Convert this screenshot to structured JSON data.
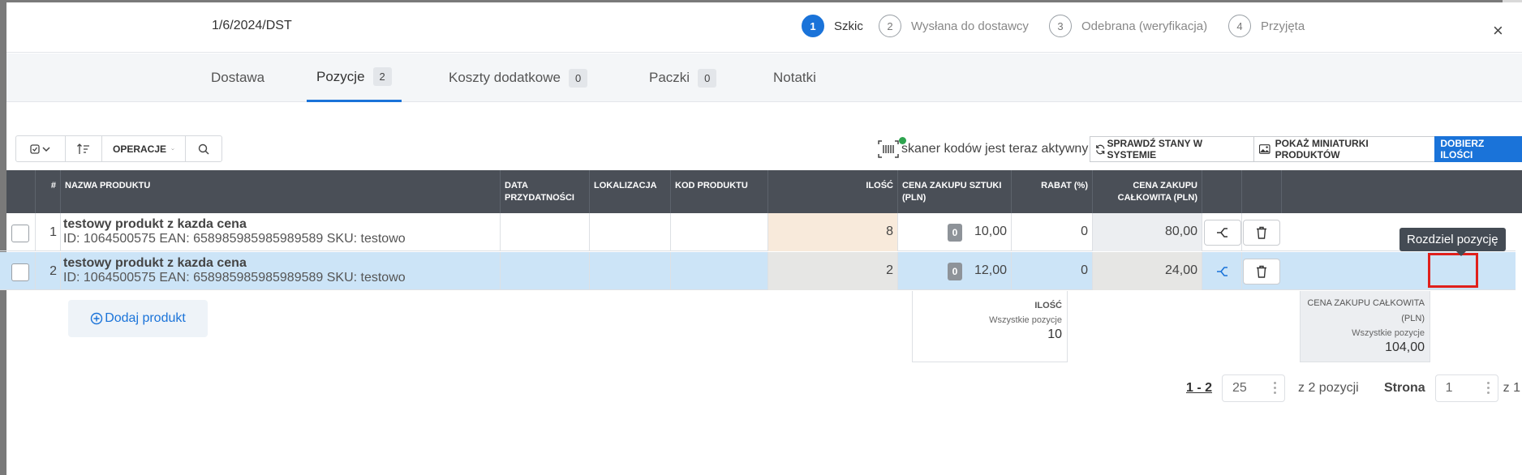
{
  "header": {
    "doc_number": "1/6/2024/DST",
    "steps": [
      {
        "num": "1",
        "label": "Szkic"
      },
      {
        "num": "2",
        "label": "Wysłana do dostawcy"
      },
      {
        "num": "3",
        "label": "Odebrana (weryfikacja)"
      },
      {
        "num": "4",
        "label": "Przyjęta"
      }
    ],
    "close": "×"
  },
  "tabs": [
    {
      "label": "Dostawa"
    },
    {
      "label": "Pozycje",
      "badge": "2"
    },
    {
      "label": "Koszty dodatkowe",
      "badge": "0"
    },
    {
      "label": "Paczki",
      "badge": "0"
    },
    {
      "label": "Notatki"
    }
  ],
  "toolbar": {
    "operations_label": "OPERACJE",
    "scanner_text": "skaner kodów jest teraz aktywny",
    "check_stock": "SPRAWDŹ STANY W SYSTEMIE",
    "show_thumbs": "POKAŻ MINIATURKI PRODUKTÓW",
    "pick_qty": "DOBIERZ ILOŚCI"
  },
  "table": {
    "headers": {
      "idx": "#",
      "name": "NAZWA PRODUKTU",
      "expiry": "DATA PRZYDATNOŚCI",
      "location": "LOKALIZACJA",
      "code": "KOD PRODUKTU",
      "qty": "ILOŚĆ",
      "unit_price": "CENA ZAKUPU SZTUKI (PLN)",
      "discount": "RABAT (%)",
      "total": "CENA ZAKUPU CAŁKOWITA (PLN)"
    },
    "rows": [
      {
        "idx": "1",
        "name": "testowy produkt z kazda cena",
        "meta": "ID: 1064500575 EAN: 658985985985989589 SKU: testowo",
        "qty_badge": "0",
        "qty": "8",
        "unit_price": "10,00",
        "discount": "0",
        "total": "80,00"
      },
      {
        "idx": "2",
        "name": "testowy produkt z kazda cena",
        "meta": "ID: 1064500575 EAN: 658985985985989589 SKU: testowo",
        "qty_badge": "0",
        "qty": "2",
        "unit_price": "12,00",
        "discount": "0",
        "total": "24,00"
      }
    ],
    "tooltip": "Rozdziel pozycję",
    "add_product": "Dodaj produkt",
    "summary": {
      "qty_title": "ILOŚĆ",
      "qty_sub": "Wszystkie pozycje",
      "qty_value": "10",
      "total_title": "CENA ZAKUPU CAŁKOWITA (PLN)",
      "total_sub": "Wszystkie pozycje",
      "total_value": "104,00"
    }
  },
  "pagination": {
    "range": "1 - 2",
    "per_page": "25",
    "of_total": "z 2 pozycji",
    "page_label": "Strona",
    "page": "1",
    "of_pages": "z 1"
  },
  "colors": {
    "accent": "#1a73d9",
    "header_dark": "#4a4f57",
    "selected_row": "#cce4f7",
    "highlight": "#e0201c"
  }
}
